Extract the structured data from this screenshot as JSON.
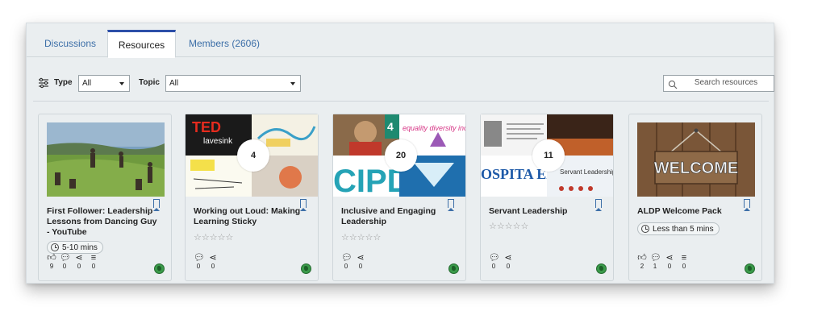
{
  "tabs": [
    {
      "label": "Discussions"
    },
    {
      "label": "Resources"
    },
    {
      "label": "Members (2606)"
    }
  ],
  "filters": {
    "type_label": "Type",
    "type_value": "All",
    "topic_label": "Topic",
    "topic_value": "All",
    "search_placeholder": "Search resources"
  },
  "cards": [
    {
      "title": "First Follower: Leadership Lessons from Dancing Guy - YouTube",
      "duration": "5-10 mins",
      "stats": {
        "likes": "9",
        "comments": "0",
        "shares": "0",
        "adds": "0"
      }
    },
    {
      "title": "Working out Loud: Making Learning Sticky",
      "count": "4",
      "rating": "☆☆☆☆☆",
      "stats": {
        "comments": "0",
        "shares": "0"
      }
    },
    {
      "title": "Inclusive and Engaging Leadership",
      "count": "20",
      "rating": "☆☆☆☆☆",
      "stats": {
        "comments": "0",
        "shares": "0"
      }
    },
    {
      "title": "Servant Leadership",
      "count": "11",
      "rating": "☆☆☆☆☆",
      "stats": {
        "comments": "0",
        "shares": "0"
      }
    },
    {
      "title": "ALDP Welcome Pack",
      "duration": "Less than 5 mins",
      "stats": {
        "likes": "2",
        "comments": "1",
        "shares": "0",
        "adds": "0"
      }
    }
  ],
  "thumb_text": {
    "ted": "TED",
    "ted_sub": "lavesink",
    "cipd": "CIPD",
    "equality": "equality diversity inclusion",
    "channel4": "4",
    "hospital": "OSPITA EDICIN",
    "servant": "Servant Leadership",
    "welcome": "WELCOME"
  },
  "icons": {
    "filter": "sliders-icon",
    "search": "search-icon",
    "clock": "clock-icon",
    "like": "thumbs-up-icon",
    "comment": "comment-icon",
    "share": "share-icon",
    "add": "add-to-list-icon",
    "bookmark": "bookmark-icon",
    "globe": "globe-icon"
  },
  "colors": {
    "accent": "#2c4fa8",
    "link": "#3d6fa8",
    "panel": "#eaeef0",
    "globe": "#3a9a4a"
  }
}
